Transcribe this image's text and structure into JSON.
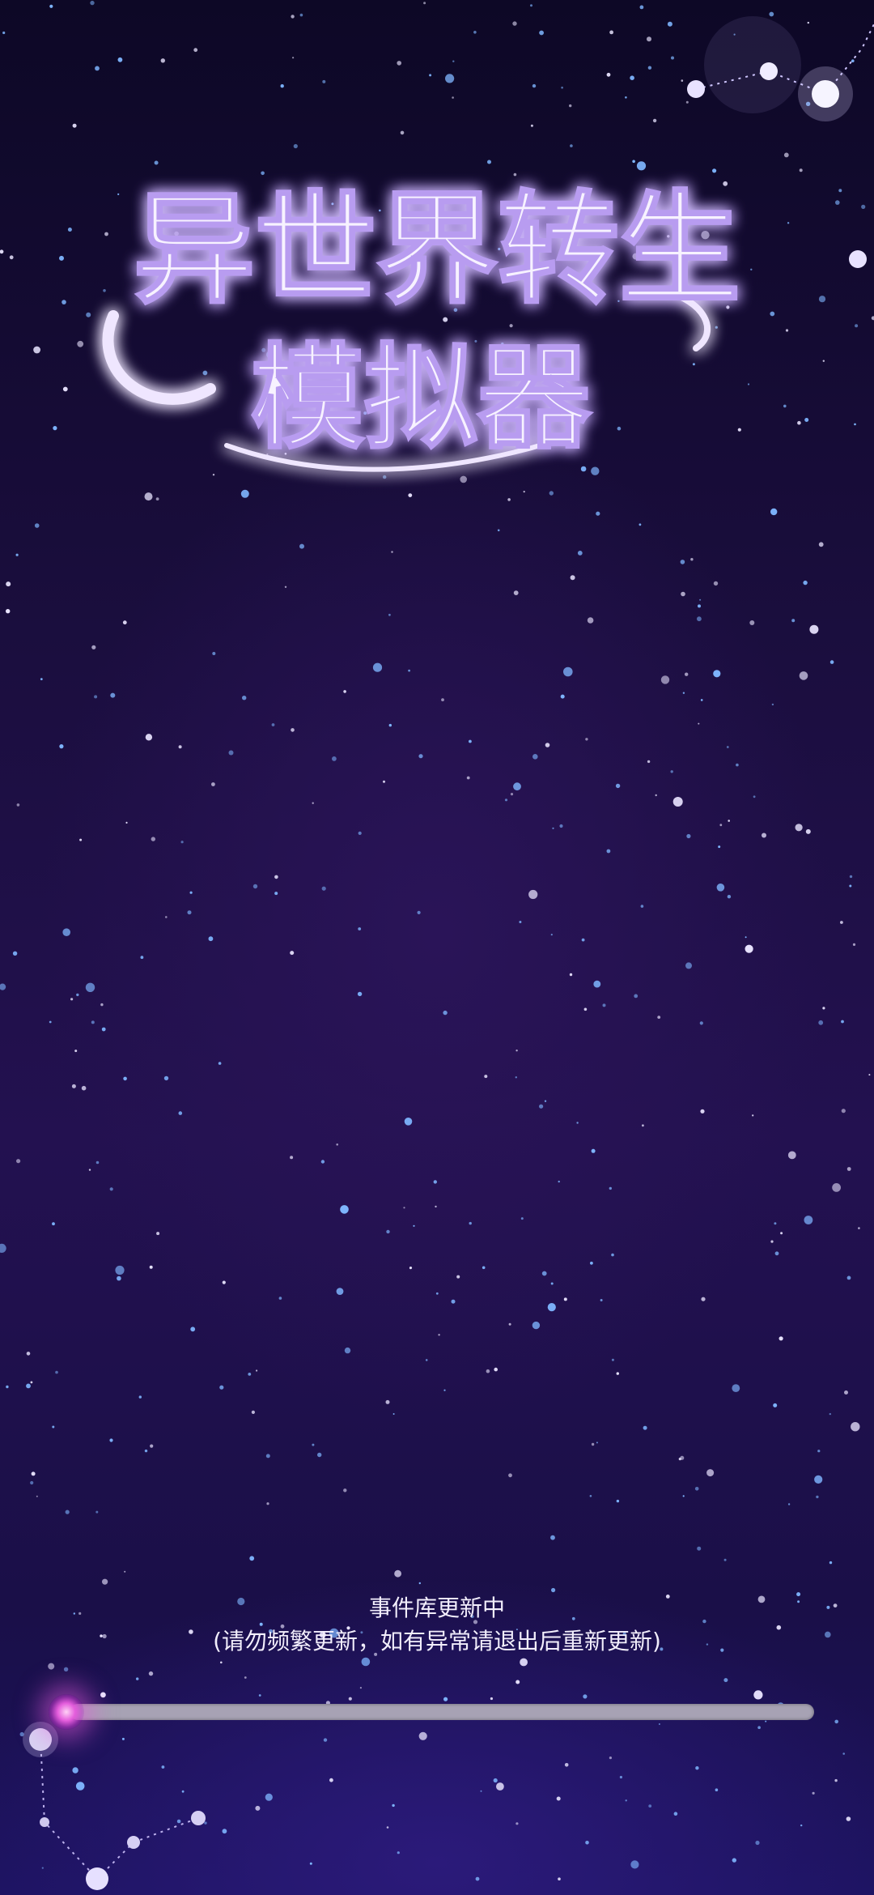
{
  "game": {
    "title_line1": "异世界转生",
    "title_line2": "模拟器"
  },
  "loading": {
    "status_line1": "事件库更新中",
    "status_line2": "(请勿频繁更新，如有异常请退出后重新更新)",
    "progress": 0.0
  },
  "colors": {
    "background": "#1b0e3f",
    "title_glow": "#b89cf0",
    "orb": "#e45ddc",
    "progress_track": "#a7a2b4"
  },
  "icons": [
    "star-field",
    "constellation",
    "progress-orb"
  ]
}
